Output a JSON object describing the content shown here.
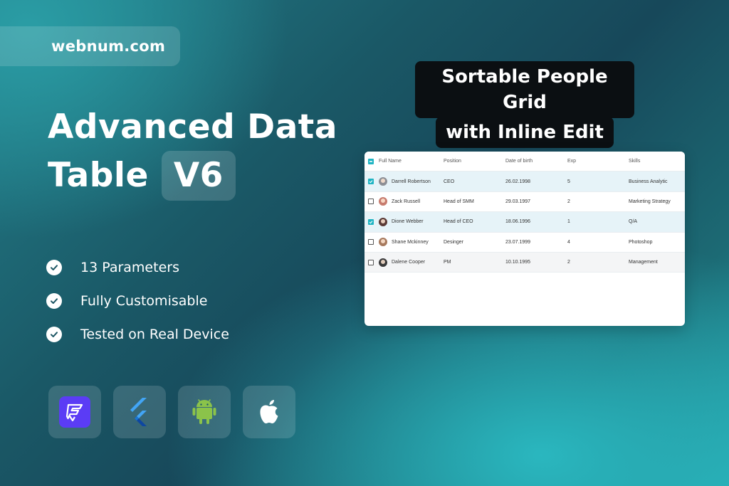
{
  "brand": {
    "site": "webnum.com"
  },
  "hero": {
    "line1": "Advanced Data",
    "line2": "Table",
    "version": "V6"
  },
  "features": [
    {
      "label": "13 Parameters"
    },
    {
      "label": "Fully Customisable"
    },
    {
      "label": "Tested on Real Device"
    }
  ],
  "platforms": [
    {
      "icon": "flutterflow-icon"
    },
    {
      "icon": "flutter-icon"
    },
    {
      "icon": "android-icon"
    },
    {
      "icon": "apple-icon"
    }
  ],
  "callout": {
    "line1": "Sortable People Grid",
    "line2": "with Inline Edit"
  },
  "table": {
    "columns": [
      "Full Name",
      "Position",
      "Date of birth",
      "Exp",
      "Skills"
    ],
    "rows": [
      {
        "name": "Darrell Robertson",
        "position": "CEO",
        "dob": "26.02.1998",
        "exp": "5",
        "skills": "Business Analytic",
        "checked": true
      },
      {
        "name": "Zack Russell",
        "position": "Head of SMM",
        "dob": "29.03.1997",
        "exp": "2",
        "skills": "Marketing Strategy",
        "checked": false
      },
      {
        "name": "Dione Webber",
        "position": "Head of CEO",
        "dob": "18.06.1996",
        "exp": "1",
        "skills": "Q/A",
        "checked": true
      },
      {
        "name": "Shane Mckinney",
        "position": "Desinger",
        "dob": "23.07.1999",
        "exp": "4",
        "skills": "Photoshop",
        "checked": false
      },
      {
        "name": "Dalene Cooper",
        "position": "PM",
        "dob": "10.10.1995",
        "exp": "2",
        "skills": "Management",
        "checked": false
      }
    ]
  },
  "colors": {
    "accent": "#1fb4c3",
    "flutterflow": "#5b3cf5",
    "flutter": "#42a5f5",
    "android": "#8bc34a"
  }
}
